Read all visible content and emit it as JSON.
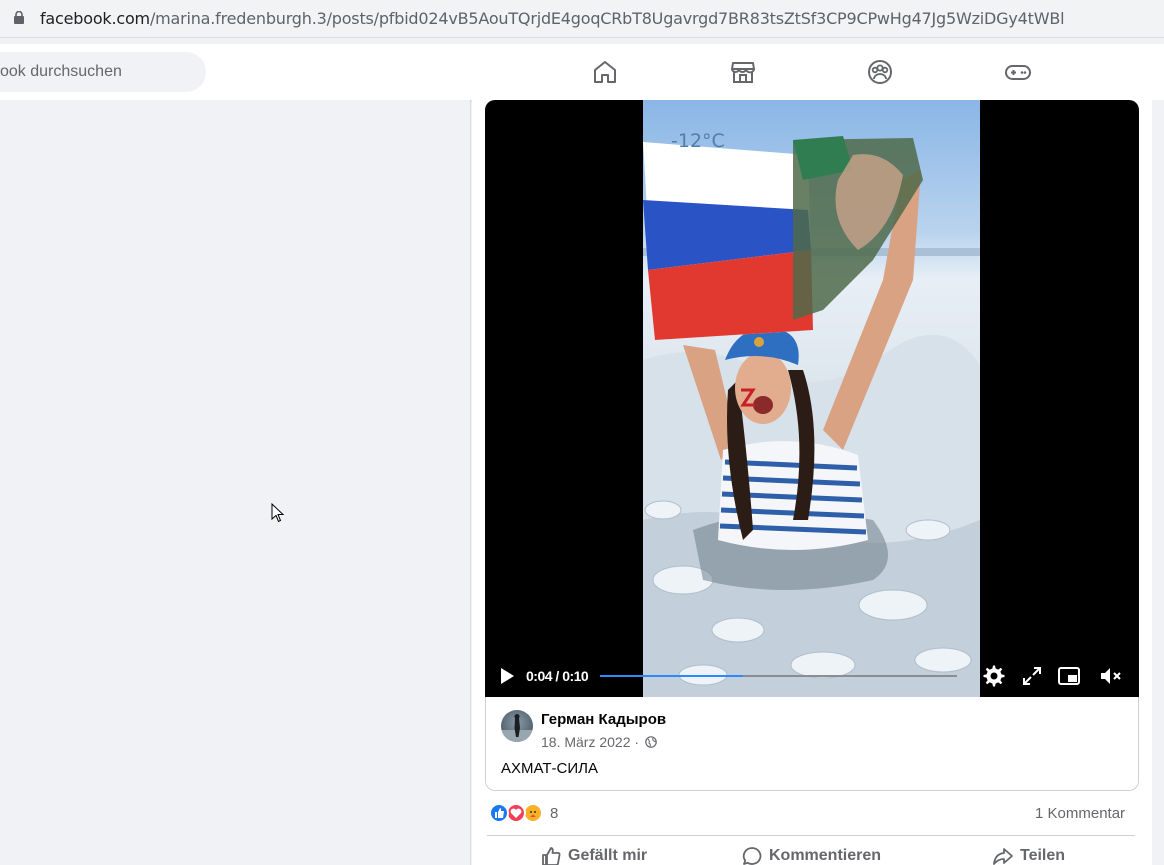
{
  "browser": {
    "url_domain": "facebook.com",
    "url_path": "/marina.fredenburgh.3/posts/pfbid024vB5AouTQrjdE4goqCRbT8Ugavrgd7BR83tsZtSf3CP9CPwHg47Jg5WziDGy4tWBl"
  },
  "header": {
    "search_text": "ook durchsuchen",
    "nav_icons": [
      "home-icon",
      "marketplace-icon",
      "groups-icon",
      "gaming-icon"
    ]
  },
  "video": {
    "overlay_text": "-12°C",
    "time_display": "0:04 / 0:10",
    "progress": 0.4,
    "accent_color": "#2d88ff"
  },
  "shared_post": {
    "author": "Герман Кадыров",
    "date": "18. März 2022 ·",
    "text": "АХМАТ-СИЛА"
  },
  "engagement": {
    "reaction_count": "8",
    "comments": "1 Kommentar"
  },
  "actions": {
    "like": "Gefällt mir",
    "comment": "Kommentieren",
    "share": "Teilen"
  }
}
